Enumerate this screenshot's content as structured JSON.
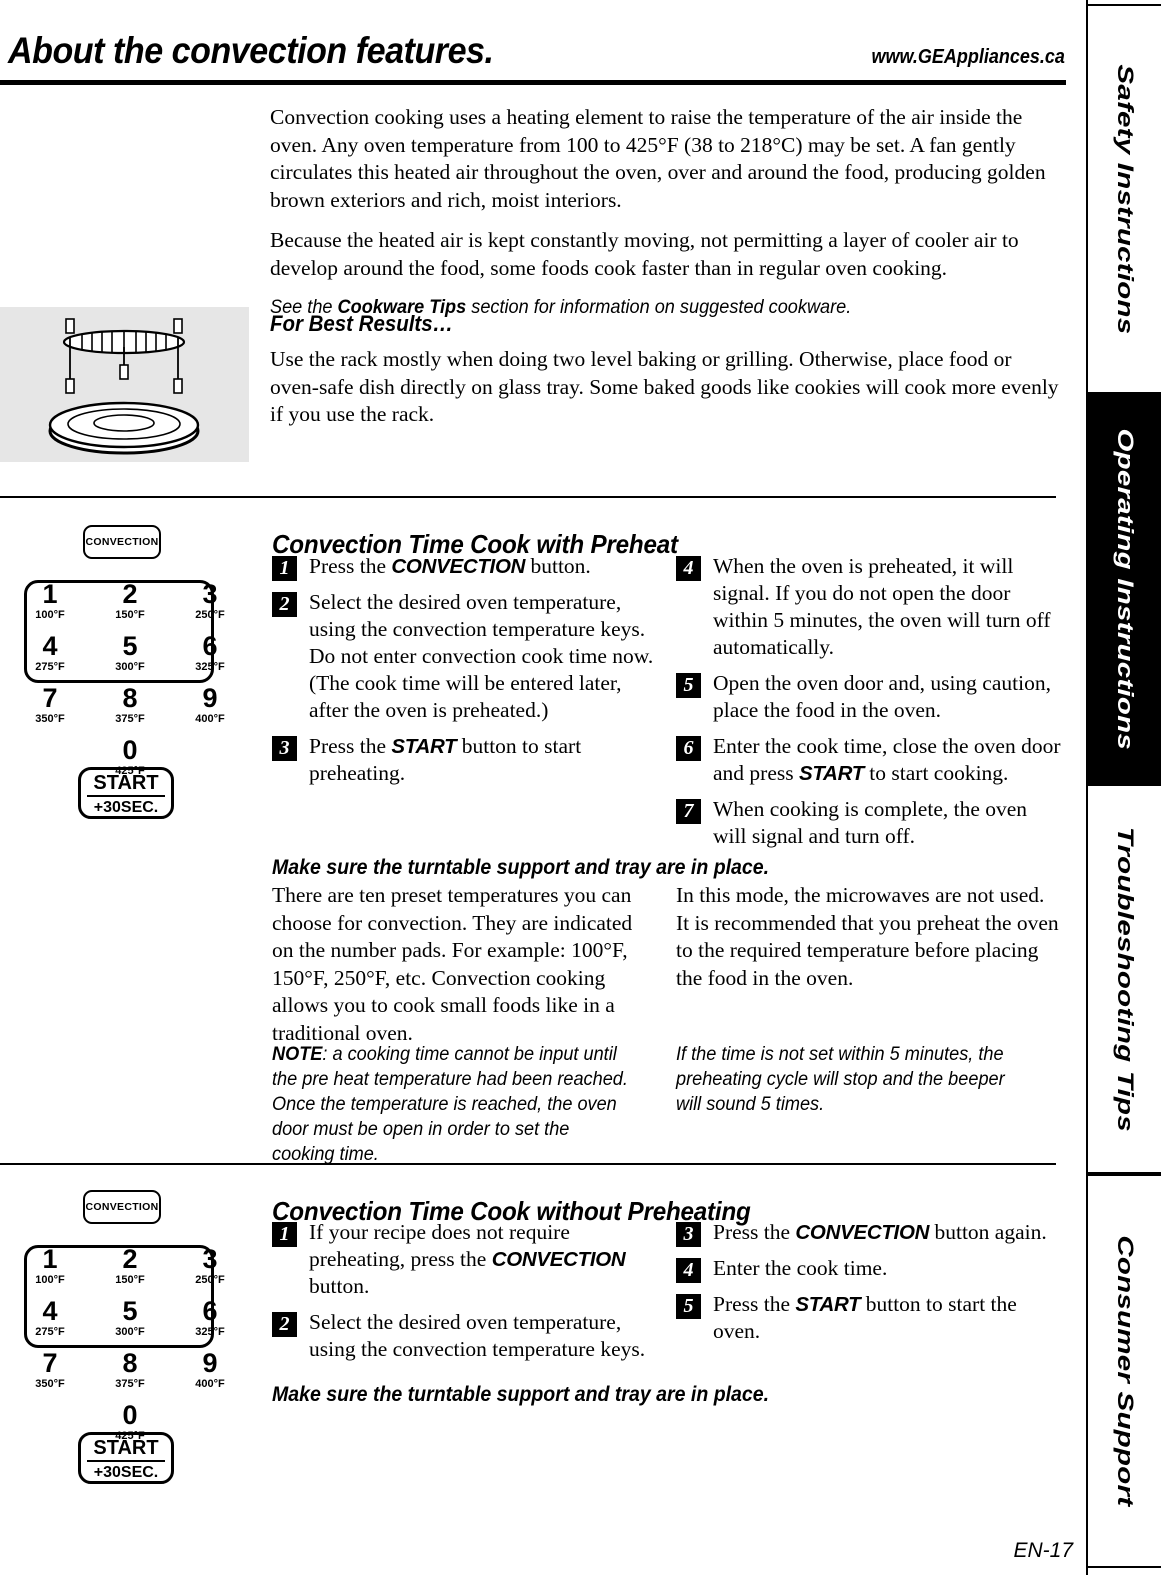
{
  "header": {
    "title": "About the convection features.",
    "url": "www.GEAppliances.ca"
  },
  "intro": {
    "p1": "Convection cooking uses a heating element to raise the temperature of the air inside the oven. Any oven temperature from 100 to 425°F (38 to 218°C) may be set. A fan gently circulates this heated air throughout the oven, over and around the food, producing golden brown exteriors and rich, moist interiors.",
    "p2": "Because the heated air is kept constantly moving, not permitting a layer of cooler air to develop around the food, some foods cook faster than in regular oven cooking.",
    "cookware_note_pre": "See the ",
    "cookware_note_bold": "Cookware Tips",
    "cookware_note_post": " section for information on suggested cookware.",
    "best_results_heading": "For Best Results…",
    "best_results_body": "Use the rack mostly when doing two level baking or grilling. Otherwise, place food or oven-safe dish directly on glass tray. Some baked goods like cookies will cook more evenly if you use the rack."
  },
  "keypad": {
    "convection_label": "CONVECTION",
    "start_label": "START",
    "start_sub": "+30SEC.",
    "keys": [
      {
        "digit": "1",
        "temp": "100°F"
      },
      {
        "digit": "2",
        "temp": "150°F"
      },
      {
        "digit": "3",
        "temp": "250°F"
      },
      {
        "digit": "4",
        "temp": "275°F"
      },
      {
        "digit": "5",
        "temp": "300°F"
      },
      {
        "digit": "6",
        "temp": "325°F"
      },
      {
        "digit": "7",
        "temp": "350°F"
      },
      {
        "digit": "8",
        "temp": "375°F"
      },
      {
        "digit": "9",
        "temp": "400°F"
      },
      {
        "digit": "0",
        "temp": "425°F"
      }
    ]
  },
  "section1": {
    "heading": "Convection Time Cook with Preheat",
    "steps_left": [
      {
        "n": "1",
        "pre": "Press the ",
        "bold": "CONVECTION",
        "post": " button."
      },
      {
        "n": "2",
        "pre": "Select the desired oven temperature, using the convection temperature keys. Do not enter convection cook time now. (The cook time will be entered later, after the oven is preheated.)",
        "bold": "",
        "post": ""
      },
      {
        "n": "3",
        "pre": "Press the ",
        "bold": "START",
        "post": " button to start preheating."
      }
    ],
    "steps_right": [
      {
        "n": "4",
        "pre": "When the oven is preheated, it will signal. If you do not open the door within 5 minutes, the oven will turn off automatically.",
        "bold": "",
        "post": ""
      },
      {
        "n": "5",
        "pre": "Open the oven door and, using caution, place the food in the oven.",
        "bold": "",
        "post": ""
      },
      {
        "n": "6",
        "pre": "Enter the cook time, close the oven door and press ",
        "bold": "START",
        "post": " to start cooking."
      },
      {
        "n": "7",
        "pre": "When cooking is complete, the oven will signal and turn off.",
        "bold": "",
        "post": ""
      }
    ],
    "turntable_notice": "Make sure the turntable support and tray are in place.",
    "body_left": "There are ten preset temperatures you can choose for convection. They are indicated on the number pads. For example: 100°F, 150°F, 250°F, etc. Convection cooking allows you to cook small foods like in a traditional oven.",
    "body_right": "In this mode, the microwaves are not used. It is recommended that you preheat the oven to the required temperature before placing the food in the oven.",
    "note_label": "NOTE",
    "note_body": ": a cooking time cannot be input until the pre heat temperature had been reached. Once the temperature is reached, the oven door must be open in order to set the cooking time.",
    "note_right": "If the time is not set within 5 minutes, the preheating cycle will stop and the beeper will sound 5 times."
  },
  "section2": {
    "heading": "Convection Time Cook without Preheating",
    "steps_left": [
      {
        "n": "1",
        "pre": "If your recipe does not require preheating, press the ",
        "bold": "CONVECTION",
        "post": " button."
      },
      {
        "n": "2",
        "pre": "Select the desired oven temperature, using the convection temperature keys.",
        "bold": "",
        "post": ""
      }
    ],
    "steps_right": [
      {
        "n": "3",
        "pre": "Press the ",
        "bold": "CONVECTION",
        "post": " button again."
      },
      {
        "n": "4",
        "pre": "Enter the cook time.",
        "bold": "",
        "post": ""
      },
      {
        "n": "5",
        "pre": "Press the ",
        "bold": "START",
        "post": " button to start the oven."
      }
    ],
    "turntable_notice": "Make sure the turntable support and tray are in place."
  },
  "sidebar": {
    "tabs": [
      {
        "label": "Safety Instructions",
        "active": false
      },
      {
        "label": "Operating Instructions",
        "active": true
      },
      {
        "label": "Troubleshooting Tips",
        "active": false
      },
      {
        "label": "Consumer Support",
        "active": false
      }
    ]
  },
  "footer": {
    "page_number": "EN-17"
  }
}
